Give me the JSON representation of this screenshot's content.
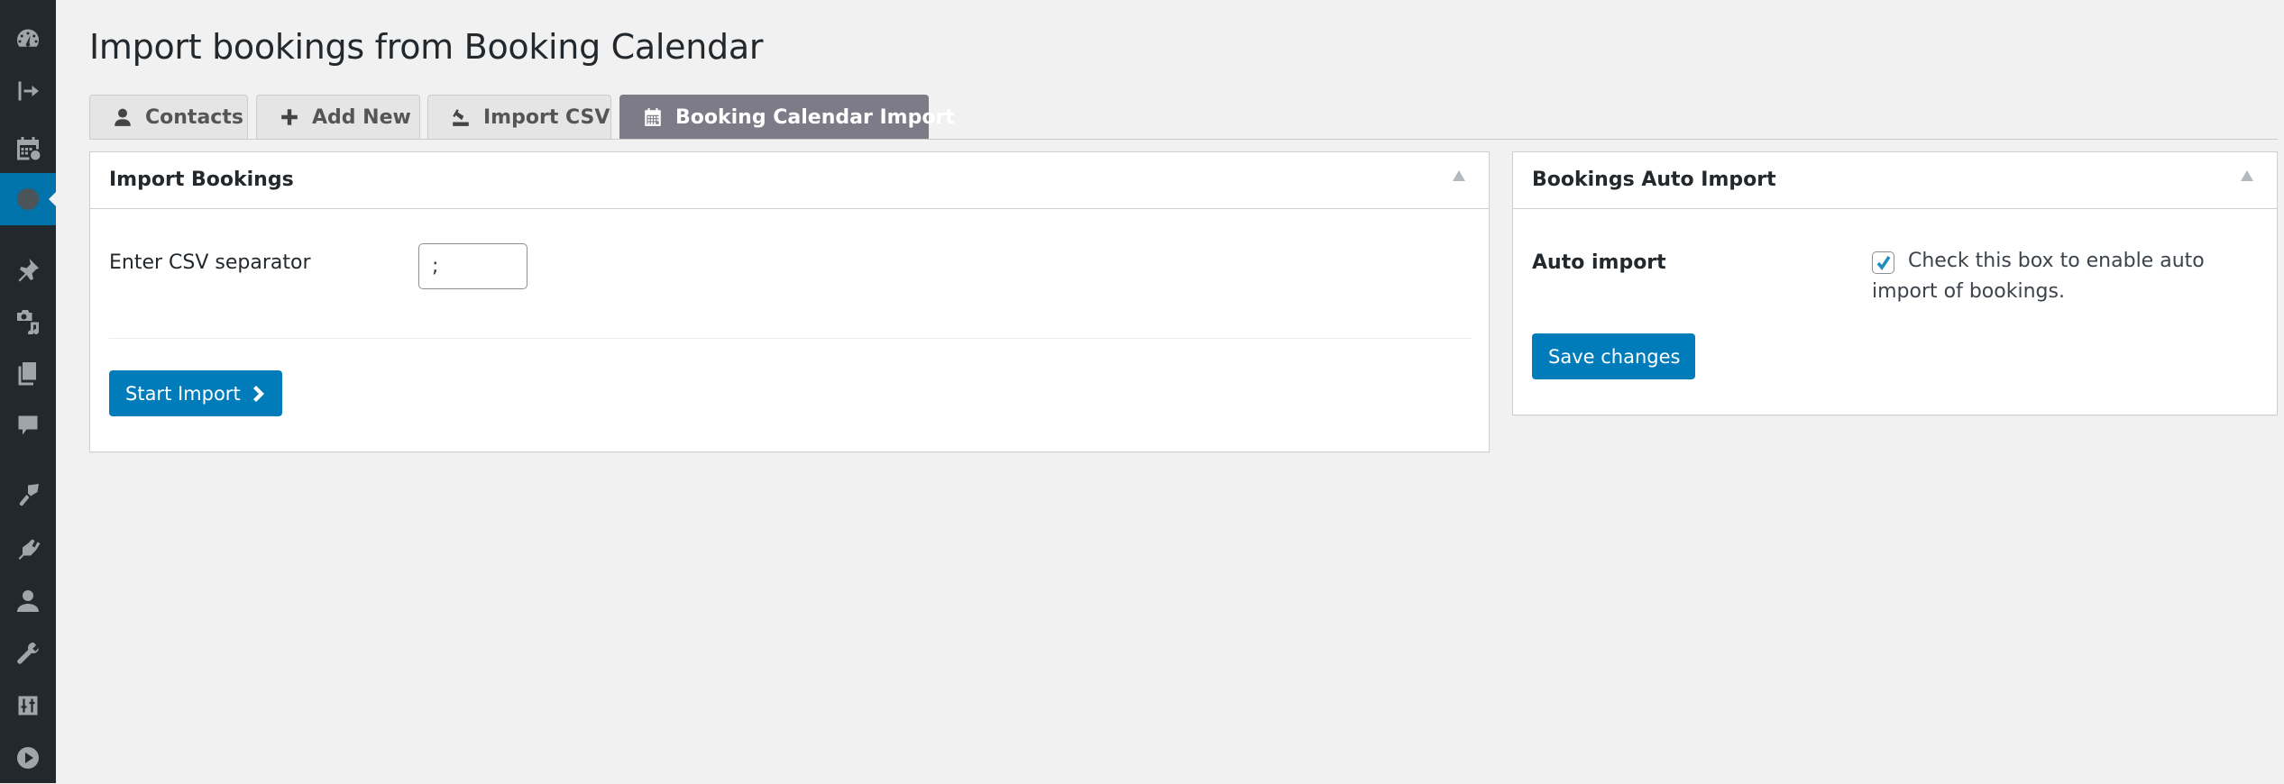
{
  "sidebar": {
    "items": [
      {
        "icon": "dashboard-icon",
        "active": false
      },
      {
        "icon": "sign-in-icon",
        "active": false
      },
      {
        "icon": "calendar-check-icon",
        "active": false
      },
      {
        "icon": "globe-icon",
        "active": true
      },
      {
        "icon": "pushpin-icon",
        "active": false
      },
      {
        "icon": "media-icon",
        "active": false
      },
      {
        "icon": "pages-icon",
        "active": false
      },
      {
        "icon": "comments-icon",
        "active": false
      },
      {
        "icon": "appearance-icon",
        "active": false
      },
      {
        "icon": "plugins-icon",
        "active": false
      },
      {
        "icon": "users-icon",
        "active": false
      },
      {
        "icon": "tools-icon",
        "active": false
      },
      {
        "icon": "settings-icon",
        "active": false
      },
      {
        "icon": "play-icon",
        "active": false
      }
    ]
  },
  "page": {
    "title": "Import bookings from Booking Calendar"
  },
  "tabs": [
    {
      "label": "Contacts",
      "icon": "user-icon",
      "active": false
    },
    {
      "label": "Add New",
      "icon": "plus-icon",
      "active": false
    },
    {
      "label": "Import CSV",
      "icon": "import-icon",
      "active": false
    },
    {
      "label": "Booking Calendar Import",
      "icon": "calendar-icon",
      "active": true
    }
  ],
  "import_panel": {
    "title": "Import Bookings",
    "separator_label": "Enter CSV separator",
    "separator_value": ";",
    "start_button": "Start Import"
  },
  "auto_panel": {
    "title": "Bookings Auto Import",
    "auto_label": "Auto import",
    "checkbox_checked": true,
    "checkbox_desc_line1": "Check this box to enable auto",
    "checkbox_desc_line2": "import of bookings.",
    "save_button": "Save changes"
  },
  "colors": {
    "sidebar_bg": "#23282d",
    "sidebar_active": "#0073aa",
    "primary_button": "#007cba",
    "active_tab": "#7c7b87",
    "page_bg": "#f1f1f1"
  }
}
